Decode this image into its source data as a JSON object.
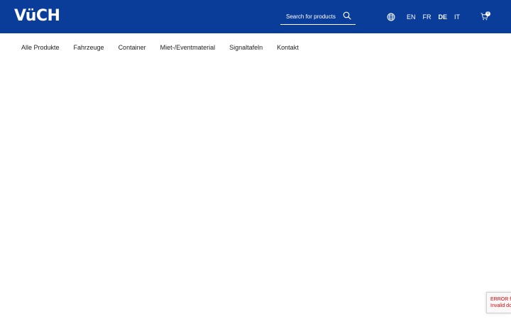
{
  "header": {
    "logo_text": "VüCH",
    "background_color": "#0a3d9a"
  },
  "search": {
    "placeholder": "Search for products",
    "icon": "search-icon"
  },
  "languages": {
    "icon": "globe-icon",
    "items": [
      "EN",
      "FR",
      "DE",
      "IT"
    ],
    "active": "DE"
  },
  "cart": {
    "icon": "cart-icon",
    "count": "0"
  },
  "nav": {
    "items": [
      "Alle Produkte",
      "Fahrzeuge",
      "Container",
      "Miet-/Eventmaterial",
      "Signaltafeln",
      "Kontakt"
    ]
  },
  "recaptcha": {
    "line1": "ERROR fo",
    "line2": "Invalid do"
  }
}
